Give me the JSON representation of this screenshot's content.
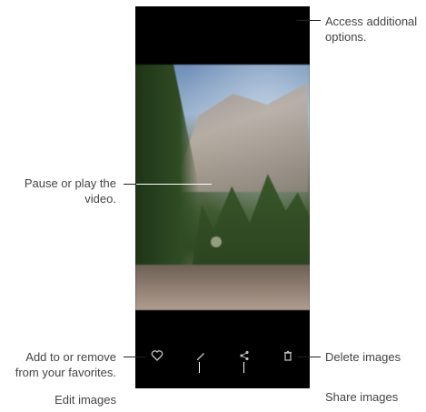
{
  "callouts": {
    "options": "Access additional options.",
    "play": "Pause or play the video.",
    "favorites": "Add to or remove from your favorites.",
    "edit": "Edit images",
    "delete": "Delete images",
    "share": "Share images"
  },
  "toolbar": {
    "icons": [
      "heart-icon",
      "pencil-icon",
      "share-icon",
      "trash-icon"
    ]
  }
}
